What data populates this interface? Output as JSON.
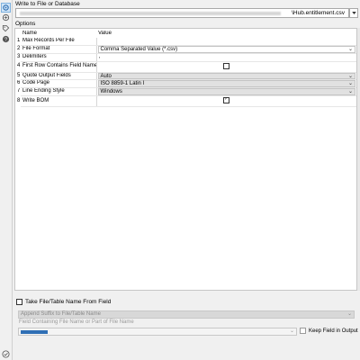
{
  "left_rail": {
    "icons": [
      "settings-icon",
      "connection-icon",
      "tag-icon",
      "help-icon"
    ],
    "bottom_icon": "check-circle-icon"
  },
  "output": {
    "section_label": "Write to File or Database",
    "path_visible": "\\Hub.entitlement.csv"
  },
  "options": {
    "section_label": "Options",
    "columns": [
      "Name",
      "Value"
    ],
    "rows": [
      {
        "index": "1",
        "name": "Max Records Per File",
        "value": ""
      },
      {
        "index": "2",
        "name": "File Format",
        "value": "Comma Separated Value (*.csv)"
      },
      {
        "index": "3",
        "name": "Delimiters",
        "value": ","
      },
      {
        "index": "4",
        "name": "First Row Contains Field Names",
        "value": ""
      },
      {
        "index": "5",
        "name": "Quote Output Fields",
        "value": "Auto"
      },
      {
        "index": "6",
        "name": "Code Page",
        "value": "ISO 8859-1 Latin I"
      },
      {
        "index": "7",
        "name": "Line Ending Style",
        "value": "Windows"
      },
      {
        "index": "8",
        "name": "Write BOM",
        "value": ""
      }
    ]
  },
  "take_field": {
    "label": "Take File/Table Name From Field",
    "append_select": "Append Suffix to File/Table Name",
    "field_label": "Field Containing File Name or Part of File Name",
    "keep_label": "Keep Field in Output"
  }
}
